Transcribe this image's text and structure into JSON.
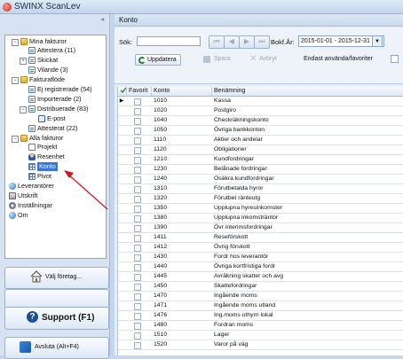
{
  "app": {
    "title": "SWINX ScanLev",
    "collapse_glyph": "«"
  },
  "tree": [
    {
      "label": "Mina fakturor",
      "icon": "folder-icon"
    },
    {
      "label": "Attestera (11)",
      "icon": "document-icon"
    },
    {
      "label": "Skickat",
      "icon": "document-icon"
    },
    {
      "label": "Vilande (3)",
      "icon": "document-icon"
    },
    {
      "label": "Fakturaflöde",
      "icon": "folder-icon"
    },
    {
      "label": "Ej registrerade (54)",
      "icon": "document-icon"
    },
    {
      "label": "Importerade (2)",
      "icon": "document-icon"
    },
    {
      "label": "Distribuerade (83)",
      "icon": "document-icon"
    },
    {
      "label": "E-post",
      "icon": "mail-icon"
    },
    {
      "label": "Attesterat (22)",
      "icon": "document-icon"
    },
    {
      "label": "Alla fakturor",
      "icon": "folder-icon"
    },
    {
      "label": "Projekt",
      "icon": "chart-icon"
    },
    {
      "label": "Resenhet",
      "icon": "person-icon"
    },
    {
      "label": "Konto",
      "icon": "grid-icon"
    },
    {
      "label": "Pivot",
      "icon": "grid-icon"
    },
    {
      "label": "Leverantörer",
      "icon": "globe-icon"
    },
    {
      "label": "Utskrift",
      "icon": "printer-icon"
    },
    {
      "label": "Inställningar",
      "icon": "gear-icon"
    },
    {
      "label": "Om",
      "icon": "globe-icon"
    }
  ],
  "left_buttons": {
    "choose_company": "Välj företag...",
    "support": "Support (F1)",
    "exit": "Avsluta (Alt+F4)"
  },
  "panel": {
    "title": "Konto",
    "search_label": "Sök:",
    "search_value": "",
    "bokfar_label": "Bokf.År:",
    "bokfar_value": "2015-01-01 - 2015-12-31",
    "update_label": "Uppdatera",
    "save_label": "Spara",
    "cancel_label": "Avbryt",
    "only_used_label": "Endast använda/favoriter"
  },
  "grid": {
    "columns": [
      "Favorit",
      "Konto",
      "Benämning"
    ],
    "rows": [
      {
        "konto": "1010",
        "name": "Kassa"
      },
      {
        "konto": "1020",
        "name": "Postgiro"
      },
      {
        "konto": "1040",
        "name": "Checkräkningskonto"
      },
      {
        "konto": "1050",
        "name": "Övriga bankkonton"
      },
      {
        "konto": "1110",
        "name": "Aktier och andelar"
      },
      {
        "konto": "1120",
        "name": "Obligationer"
      },
      {
        "konto": "1210",
        "name": "Kundfordringar"
      },
      {
        "konto": "1230",
        "name": "Belånade fordringar"
      },
      {
        "konto": "1240",
        "name": "Osäkra kundfordringar"
      },
      {
        "konto": "1310",
        "name": "Förutbetalda hyror"
      },
      {
        "konto": "1320",
        "name": "Förutbet ränteutg"
      },
      {
        "konto": "1350",
        "name": "Upplupna hyresinkomster"
      },
      {
        "konto": "1380",
        "name": "Upplupna inkomsträntor"
      },
      {
        "konto": "1390",
        "name": "Övr interimsfordringar"
      },
      {
        "konto": "1411",
        "name": "Reseförskott"
      },
      {
        "konto": "1412",
        "name": "Övrig förskott"
      },
      {
        "konto": "1430",
        "name": "Fordr hos leverantör"
      },
      {
        "konto": "1440",
        "name": "Övriga kortfristiga fordr"
      },
      {
        "konto": "1445",
        "name": "Avräkning skatter och avg"
      },
      {
        "konto": "1450",
        "name": "Skattefordringar"
      },
      {
        "konto": "1470",
        "name": "Ingående moms"
      },
      {
        "konto": "1471",
        "name": "Ingående moms utland"
      },
      {
        "konto": "1476",
        "name": "Ing.moms uthyrn lokal"
      },
      {
        "konto": "1480",
        "name": "Fordran moms"
      },
      {
        "konto": "1510",
        "name": "Lager"
      },
      {
        "konto": "1520",
        "name": "Varor på väg"
      }
    ]
  },
  "colors": {
    "selection": "#3875d7",
    "arrow": "#d4141b"
  }
}
